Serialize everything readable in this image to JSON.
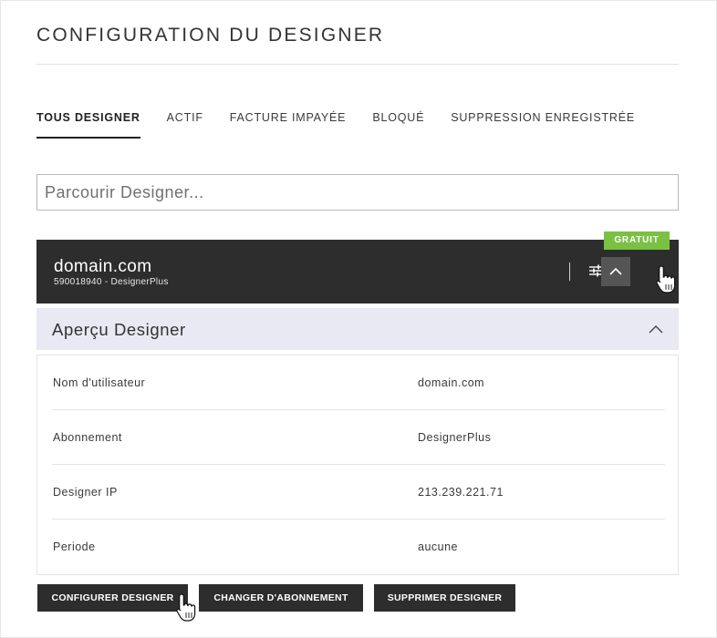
{
  "page": {
    "title": "CONFIGURATION DU DESIGNER"
  },
  "tabs": [
    {
      "label": "TOUS DESIGNER",
      "active": true
    },
    {
      "label": "ACTIF",
      "active": false
    },
    {
      "label": "FACTURE IMPAYÉE",
      "active": false
    },
    {
      "label": "BLOQUÉ",
      "active": false
    },
    {
      "label": "SUPPRESSION ENREGISTRÉE",
      "active": false
    }
  ],
  "search": {
    "placeholder": "Parcourir Designer...",
    "value": ""
  },
  "card": {
    "badge": "GRATUIT",
    "domain": "domain.com",
    "subtitle": "590018940 - DesignerPlus",
    "settings_icon": "sliders-icon",
    "collapse_icon": "chevron-up-icon"
  },
  "overview": {
    "title": "Aperçu Designer",
    "toggle_icon": "chevron-up-icon",
    "rows": [
      {
        "label": "Nom d'utilisateur",
        "value": "domain.com"
      },
      {
        "label": "Abonnement",
        "value": "DesignerPlus"
      },
      {
        "label": "Designer IP",
        "value": "213.239.221.71"
      },
      {
        "label": "Periode",
        "value": "aucune"
      }
    ]
  },
  "actions": {
    "configure_label": "CONFIGURER DESIGNER",
    "change_label": "CHANGER D'ABONNEMENT",
    "delete_label": "SUPPRIMER DESIGNER"
  },
  "colors": {
    "badge_green": "#7ac143",
    "header_dark": "#2d2d2d",
    "section_bg": "#e8e9f2"
  }
}
